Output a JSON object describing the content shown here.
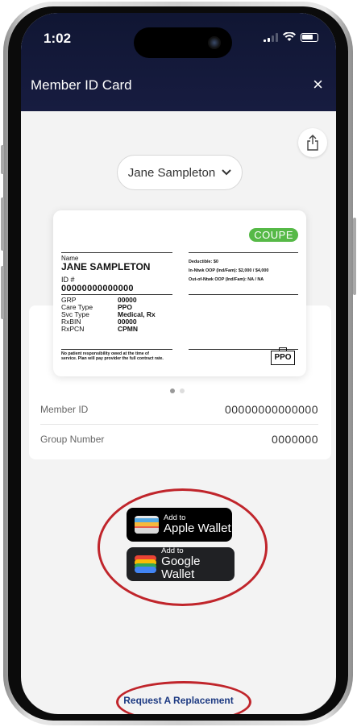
{
  "status_bar": {
    "time": "1:02"
  },
  "header": {
    "title": "Member ID Card",
    "close_symbol": "×"
  },
  "member_selector": {
    "selected": "Jane Sampleton",
    "chevron": "▾"
  },
  "card": {
    "plan_badge": "COUPE",
    "name_label": "Name",
    "name_value": "JANE SAMPLETON",
    "id_label": "ID #",
    "id_value": "00000000000000",
    "fields": [
      {
        "label": "GRP",
        "value": "00000"
      },
      {
        "label": "Care Type",
        "value": "PPO"
      },
      {
        "label": "Svc Type",
        "value": "Medical, Rx"
      },
      {
        "label": "RxBIN",
        "value": "00000"
      },
      {
        "label": "RxPCN",
        "value": "CPMN"
      }
    ],
    "deductible": "Deductible: $0",
    "in_network": "In-Ntwk OOP (Ind/Fam): $2,000 / $4,000",
    "out_network": "Out-of-Ntwk OOP (Ind/Fam): NA / NA",
    "footer_line1": "No patient responsibility owed at the time of",
    "footer_line2": "service. Plan will pay provider the full contract rate.",
    "ppo_logo": "PPO"
  },
  "pager": {
    "total": 2,
    "active": 1
  },
  "details": [
    {
      "label": "Member ID",
      "value": "00000000000000"
    },
    {
      "label": "Group Number",
      "value": "0000000"
    }
  ],
  "wallet": {
    "apple_small": "Add to",
    "apple_big": "Apple Wallet",
    "google_small": "Add to",
    "google_big": "Google Wallet"
  },
  "request_link": "Request A Replacement",
  "colors": {
    "header_bg": "#141a3a",
    "highlight_oval": "#c0252b",
    "link": "#1d3a82",
    "badge": "#56b947"
  }
}
